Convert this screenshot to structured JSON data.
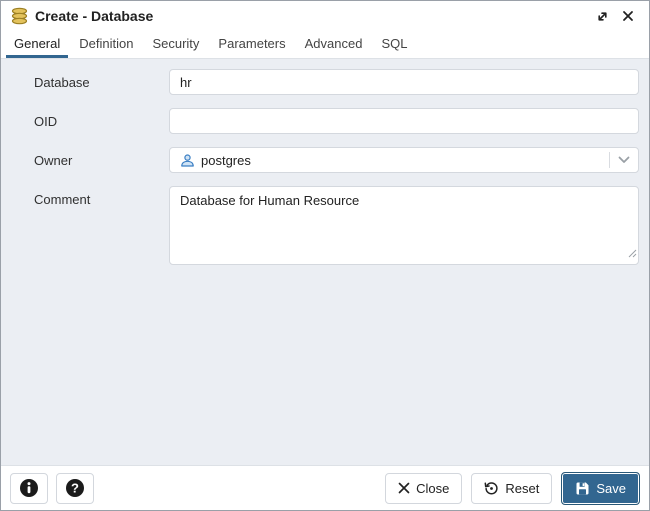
{
  "window": {
    "title": "Create - Database",
    "icon": "database-icon",
    "controls": {
      "maximize": "expand",
      "close": "close"
    }
  },
  "tabs": {
    "general": "General",
    "definition": "Definition",
    "security": "Security",
    "parameters": "Parameters",
    "advanced": "Advanced",
    "sql": "SQL",
    "active": "General"
  },
  "form": {
    "database": {
      "label": "Database",
      "value": "hr"
    },
    "oid": {
      "label": "OID",
      "value": ""
    },
    "owner": {
      "label": "Owner",
      "value": "postgres",
      "icon": "user-icon"
    },
    "comment": {
      "label": "Comment",
      "value": "Database for Human Resource"
    }
  },
  "footer": {
    "info": "info",
    "help": "help",
    "close": "Close",
    "reset": "Reset",
    "save": "Save"
  },
  "colors": {
    "primary": "#326690",
    "content_bg": "#ebeef3",
    "icon_gold": "#e3c25c",
    "user_icon_blue": "#3b7fc4"
  }
}
